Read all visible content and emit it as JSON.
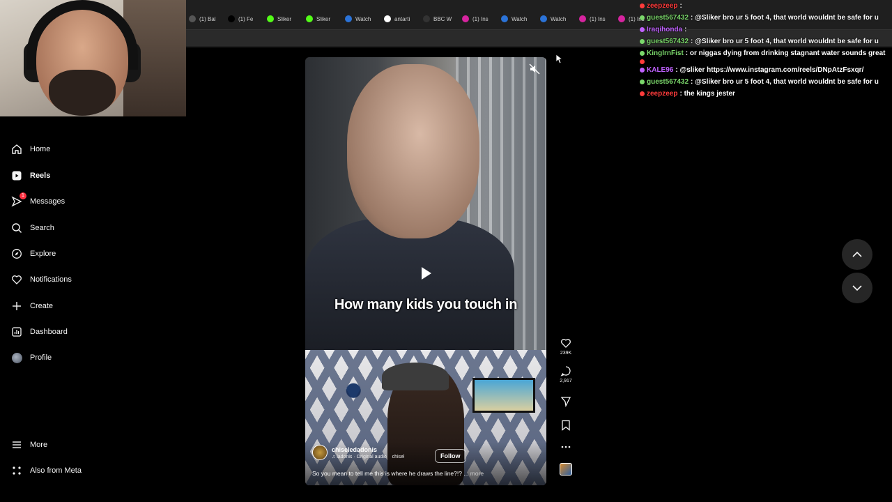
{
  "browser": {
    "tabs": [
      {
        "label": "(1) Bal",
        "icon": "generic-tab-icon",
        "color": "#555555"
      },
      {
        "label": "(1) Fe",
        "icon": "x-logo-icon",
        "color": "#000000"
      },
      {
        "label": "Sliker",
        "icon": "kick-logo-icon",
        "color": "#53fc18"
      },
      {
        "label": "Sliker",
        "icon": "kick-logo-icon",
        "color": "#53fc18"
      },
      {
        "label": "Watch",
        "icon": "watch-icon",
        "color": "#2b73d8"
      },
      {
        "label": "antarti",
        "icon": "google-icon",
        "color": "#ffffff"
      },
      {
        "label": "BBC W",
        "icon": "bbc-icon",
        "color": "#333333"
      },
      {
        "label": "(1) Ins",
        "icon": "instagram-icon",
        "color": "#d6249f"
      },
      {
        "label": "Watch",
        "icon": "watch-icon",
        "color": "#2b73d8"
      },
      {
        "label": "Watch",
        "icon": "watch-icon",
        "color": "#2b73d8"
      },
      {
        "label": "(1) Ins",
        "icon": "instagram-icon",
        "color": "#d6249f"
      },
      {
        "label": "(1) Ins",
        "icon": "instagram-icon",
        "color": "#d6249f"
      }
    ]
  },
  "sidebar": {
    "items": [
      {
        "label": "Home",
        "icon": "home-icon"
      },
      {
        "label": "Reels",
        "icon": "reels-icon",
        "active": true
      },
      {
        "label": "Messages",
        "icon": "messages-icon",
        "badge": "1"
      },
      {
        "label": "Search",
        "icon": "search-icon"
      },
      {
        "label": "Explore",
        "icon": "explore-icon"
      },
      {
        "label": "Notifications",
        "icon": "heart-icon"
      },
      {
        "label": "Create",
        "icon": "plus-icon"
      },
      {
        "label": "Dashboard",
        "icon": "dashboard-icon"
      },
      {
        "label": "Profile",
        "icon": "profile-avatar"
      }
    ],
    "more_label": "More",
    "meta_label": "Also from Meta"
  },
  "reel": {
    "caption_overlay": "How many kids you touch in",
    "author": "chiseledadonis",
    "audio": "ladonis · Original audio",
    "audio_extra": "chisel",
    "follow_label": "Follow",
    "description": "So you mean to tell me this is where he draws the line?!? ...",
    "more_label": "more",
    "likes": "239K",
    "comments": "2,917"
  },
  "chat": {
    "lines": [
      {
        "user": "zeepzeep",
        "msg": ":",
        "color": "#ff3b3b"
      },
      {
        "user": "guest567432",
        "msg": ": @Sliker bro ur 5 foot 4, that world wouldnt be safe for u",
        "color": "#7bd86b"
      },
      {
        "user": "Iraqihonda",
        "msg": ":",
        "color": "#c062ff"
      },
      {
        "user": "guest567432",
        "msg": ": @Sliker bro ur 5 foot 4, that world wouldnt be safe for u",
        "color": "#7bd86b"
      },
      {
        "user": "KingIrnFist",
        "msg": ": or niggas dying from drinking stagnant water sounds great",
        "color": "#7bd86b"
      },
      {
        "user": "",
        "msg": "",
        "color": "#ff3b3b"
      },
      {
        "user": "KALE96",
        "msg": ": @sliker https://www.instagram.com/reels/DNpAtzFsxqr/",
        "color": "#c062ff"
      },
      {
        "user": "guest567432",
        "msg": ": @Sliker bro ur 5 foot 4, that world wouldnt be safe for u",
        "color": "#7bd86b"
      },
      {
        "user": "zeepzeep",
        "msg": ": the kings jester",
        "color": "#ff3b3b"
      }
    ]
  },
  "colors": {
    "background": "#000000",
    "badge": "#ff3040",
    "nav_button": "#262626"
  }
}
